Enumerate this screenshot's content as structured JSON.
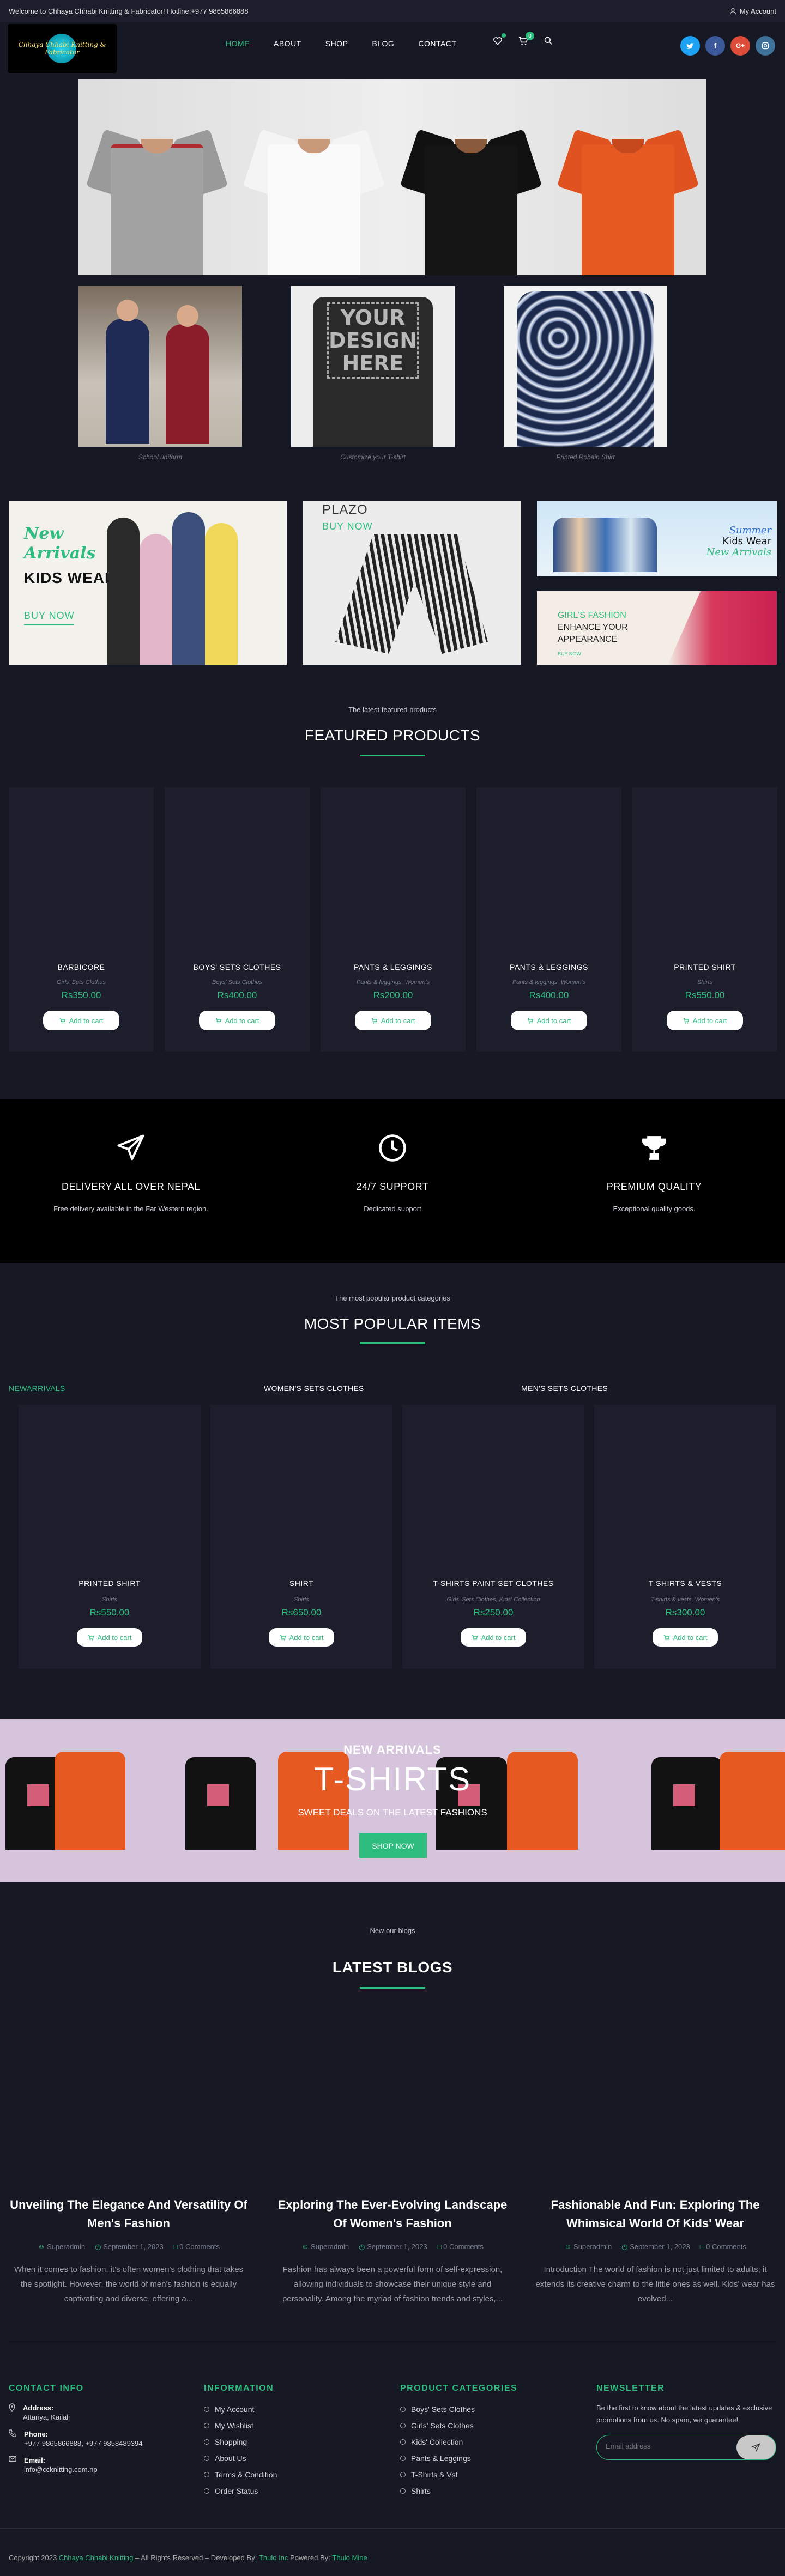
{
  "topbar": {
    "welcome": "Welcome to Chhaya Chhabi Knitting & Fabricator! Hotline:+977 9865866888",
    "account": "My Account"
  },
  "brand": {
    "logo_text": "Chhaya Chhabi Knitting & Fabricator"
  },
  "nav": [
    {
      "label": "HOME",
      "active": true
    },
    {
      "label": "ABOUT"
    },
    {
      "label": "SHOP"
    },
    {
      "label": "BLOG"
    },
    {
      "label": "CONTACT"
    }
  ],
  "cart_count": "0",
  "colors": {
    "accent": "#2ebd7e",
    "twitter": "#1da1f2",
    "facebook": "#3b5998",
    "google": "#dd4b39",
    "instagram": "#3f729b"
  },
  "social_icons": [
    "twitter-icon",
    "facebook-icon",
    "google-plus-icon",
    "instagram-icon"
  ],
  "captions": [
    "School uniform",
    "Customize your T-shirt",
    "Printed Robain Shirt"
  ],
  "design_text": [
    "YOUR",
    "DESIGN",
    "HERE"
  ],
  "banners": {
    "kids": {
      "line1": "New",
      "line2": "Arrivals",
      "line3": "KIDS WEAR",
      "cta": "BUY NOW"
    },
    "plazo": {
      "title": "PLAZO",
      "cta": "BUY NOW"
    },
    "summer": {
      "line1": "Summer",
      "line2": "Kids Wear",
      "line3": "New Arrivals"
    },
    "girls": {
      "line1": "GIRL'S FASHION",
      "line2": "ENHANCE YOUR",
      "line3": "APPEARANCE",
      "cta": "BUY NOW"
    }
  },
  "featured": {
    "subtitle": "The latest featured products",
    "title": "FEATURED PRODUCTS",
    "products": [
      {
        "name": "BARBICORE",
        "category": "Girls' Sets Clothes",
        "price": "Rs350.00",
        "button": "Add to cart"
      },
      {
        "name": "BOYS' SETS CLOTHES",
        "category": "Boys' Sets Clothes",
        "price": "Rs400.00",
        "button": "Add to cart"
      },
      {
        "name": "PANTS & LEGGINGS",
        "category": "Pants & leggings, Women's",
        "price": "Rs200.00",
        "button": "Add to cart"
      },
      {
        "name": "PANTS & LEGGINGS",
        "category": "Pants & leggings, Women's",
        "price": "Rs400.00",
        "button": "Add to cart"
      },
      {
        "name": "PRINTED SHIRT",
        "category": "Shirts",
        "price": "Rs550.00",
        "button": "Add to cart"
      }
    ]
  },
  "features": [
    {
      "icon": "paper-plane-icon",
      "title": "DELIVERY ALL OVER NEPAL",
      "desc": "Free delivery available in the Far Western region."
    },
    {
      "icon": "clock-icon",
      "title": "24/7 SUPPORT",
      "desc": "Dedicated support"
    },
    {
      "icon": "trophy-icon",
      "title": "PREMIUM QUALITY",
      "desc": "Exceptional quality goods."
    }
  ],
  "popular": {
    "subtitle": "The most popular product categories",
    "title": "MOST POPULAR ITEMS",
    "tabs": [
      {
        "label": "NEWARRIVALS",
        "active": true
      },
      {
        "label": "WOMEN'S SETS CLOTHES"
      },
      {
        "label": "MEN'S SETS CLOTHES"
      }
    ],
    "products": [
      {
        "name": "PRINTED SHIRT",
        "category": "Shirts",
        "price": "Rs550.00",
        "button": "Add to cart"
      },
      {
        "name": "SHIRT",
        "category": "Shirts",
        "price": "Rs650.00",
        "button": "Add to cart"
      },
      {
        "name": "T-SHIRTS PAINT SET CLOTHES",
        "category": "Girls' Sets Clothes, Kids' Collection",
        "price": "Rs250.00",
        "button": "Add to cart"
      },
      {
        "name": "T-SHIRTS & VESTS",
        "category": "T-shirts & vests, Women's",
        "price": "Rs300.00",
        "button": "Add to cart"
      }
    ]
  },
  "tshirt_banner": {
    "kicker": "NEW ARRIVALS",
    "title": "T-SHIRTS",
    "tagline": "SWEET DEALS ON THE LATEST FASHIONS",
    "cta": "SHOP NOW"
  },
  "blogs": {
    "subtitle": "New our blogs",
    "title": "LATEST BLOGS",
    "posts": [
      {
        "title": "Unveiling The Elegance And Versatility Of Men's Fashion",
        "author": "Superadmin",
        "date": "September 1, 2023",
        "comments": "0 Comments",
        "excerpt": "When it comes to fashion, it's often women's clothing that takes the spotlight. However, the world of men's fashion is equally captivating and diverse, offering a..."
      },
      {
        "title": "Exploring The Ever-Evolving Landscape Of Women's Fashion",
        "author": "Superadmin",
        "date": "September 1, 2023",
        "comments": "0 Comments",
        "excerpt": "Fashion has always been a powerful form of self-expression, allowing individuals to showcase their unique style and personality. Among the myriad of fashion trends and styles,..."
      },
      {
        "title": "Fashionable And Fun: Exploring The Whimsical World Of Kids' Wear",
        "author": "Superadmin",
        "date": "September 1, 2023",
        "comments": "0 Comments",
        "excerpt": "Introduction The world of fashion is not just limited to adults; it extends its creative charm to the little ones as well. Kids' wear has evolved..."
      }
    ]
  },
  "footer": {
    "contact": {
      "heading": "CONTACT INFO",
      "address_label": "Address:",
      "address": "Attariya, Kailali",
      "phone_label": "Phone:",
      "phone": "+977 9865866888, +977 9858489394",
      "email_label": "Email:",
      "email": "info@ccknitting.com.np"
    },
    "information": {
      "heading": "INFORMATION",
      "links": [
        "My Account",
        "My Wishlist",
        "Shopping",
        "About Us",
        "Terms & Condition",
        "Order Status"
      ]
    },
    "categories": {
      "heading": "PRODUCT CATEGORIES",
      "links": [
        "Boys' Sets Clothes",
        "Girls' Sets Clothes",
        "Kids' Collection",
        "Pants & Leggings",
        "T-Shirts & Vst",
        "Shirts"
      ]
    },
    "newsletter": {
      "heading": "NEWSLETTER",
      "text": "Be the first to know about the latest updates & exclusive promotions from us. No spam, we guarantee!",
      "placeholder": "Email address"
    }
  },
  "copyright": {
    "prefix": "Copyright 2023",
    "company": "Chhaya Chhabi Knitting",
    "middle": "– All Rights Reserved – Developed By:",
    "dev": "Thulo Inc",
    "powered": "Powered By:",
    "host": "Thulo Mine"
  }
}
